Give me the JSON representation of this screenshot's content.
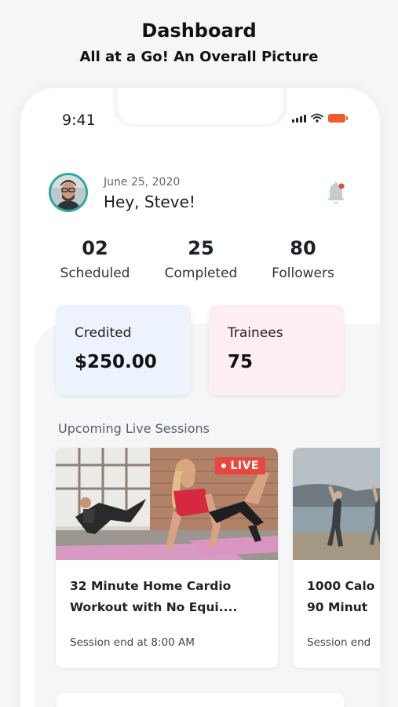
{
  "header": {
    "title": "Dashboard",
    "subtitle": "All at a Go! An Overall Picture"
  },
  "status_bar": {
    "time": "9:41",
    "battery_color": "#ef5b2b"
  },
  "profile": {
    "date": "June 25, 2020",
    "greeting": "Hey, Steve!",
    "avatar_ring_color": "#2aa8a4",
    "notification_icon": "bell-icon",
    "notification_dot_color": "#e8473f"
  },
  "stats": [
    {
      "value": "02",
      "label": "Scheduled"
    },
    {
      "value": "25",
      "label": "Completed"
    },
    {
      "value": "80",
      "label": "Followers"
    }
  ],
  "cards": {
    "credited": {
      "label": "Credited",
      "value": "$250.00",
      "color": "#edf3fc"
    },
    "trainees": {
      "label": "Trainees",
      "value": "75",
      "color": "#fdeef4"
    }
  },
  "sessions": {
    "section_title": "Upcoming Live Sessions",
    "items": [
      {
        "title": "32 Minute Home Cardio Workout with No Equi....",
        "end": "Session end at 8:00 AM",
        "badge": "LIVE"
      },
      {
        "title": "1000 Calo 90 Minut",
        "end": "Session end"
      }
    ]
  }
}
